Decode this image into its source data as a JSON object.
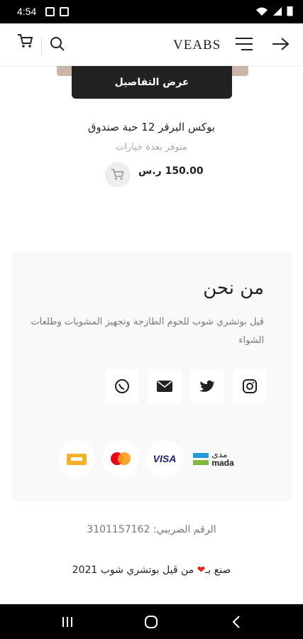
{
  "status": {
    "time": "4:54"
  },
  "header": {
    "logo": "VEABS"
  },
  "product": {
    "details_button": "عرض التفاصيل",
    "name": "بوكس البرقر 12 حبة صندوق",
    "availability": "متوفر بعدة خيارات",
    "price": "150.00",
    "currency": "ر.س"
  },
  "about": {
    "title": "من نحن",
    "description": "ڤيل بوتشري شوب للحوم الطازجة وتجهيز المشويات وطلعات الشواء"
  },
  "payments": {
    "mada_ar": "مدى",
    "mada_en": "mada",
    "visa": "VISA"
  },
  "footer": {
    "vat_label": "الرقم الضريبي:",
    "vat_number": "3101157162",
    "made_prefix": "صنع بـ",
    "made_suffix": "من ڤيل بوتشري شوب 2021"
  }
}
